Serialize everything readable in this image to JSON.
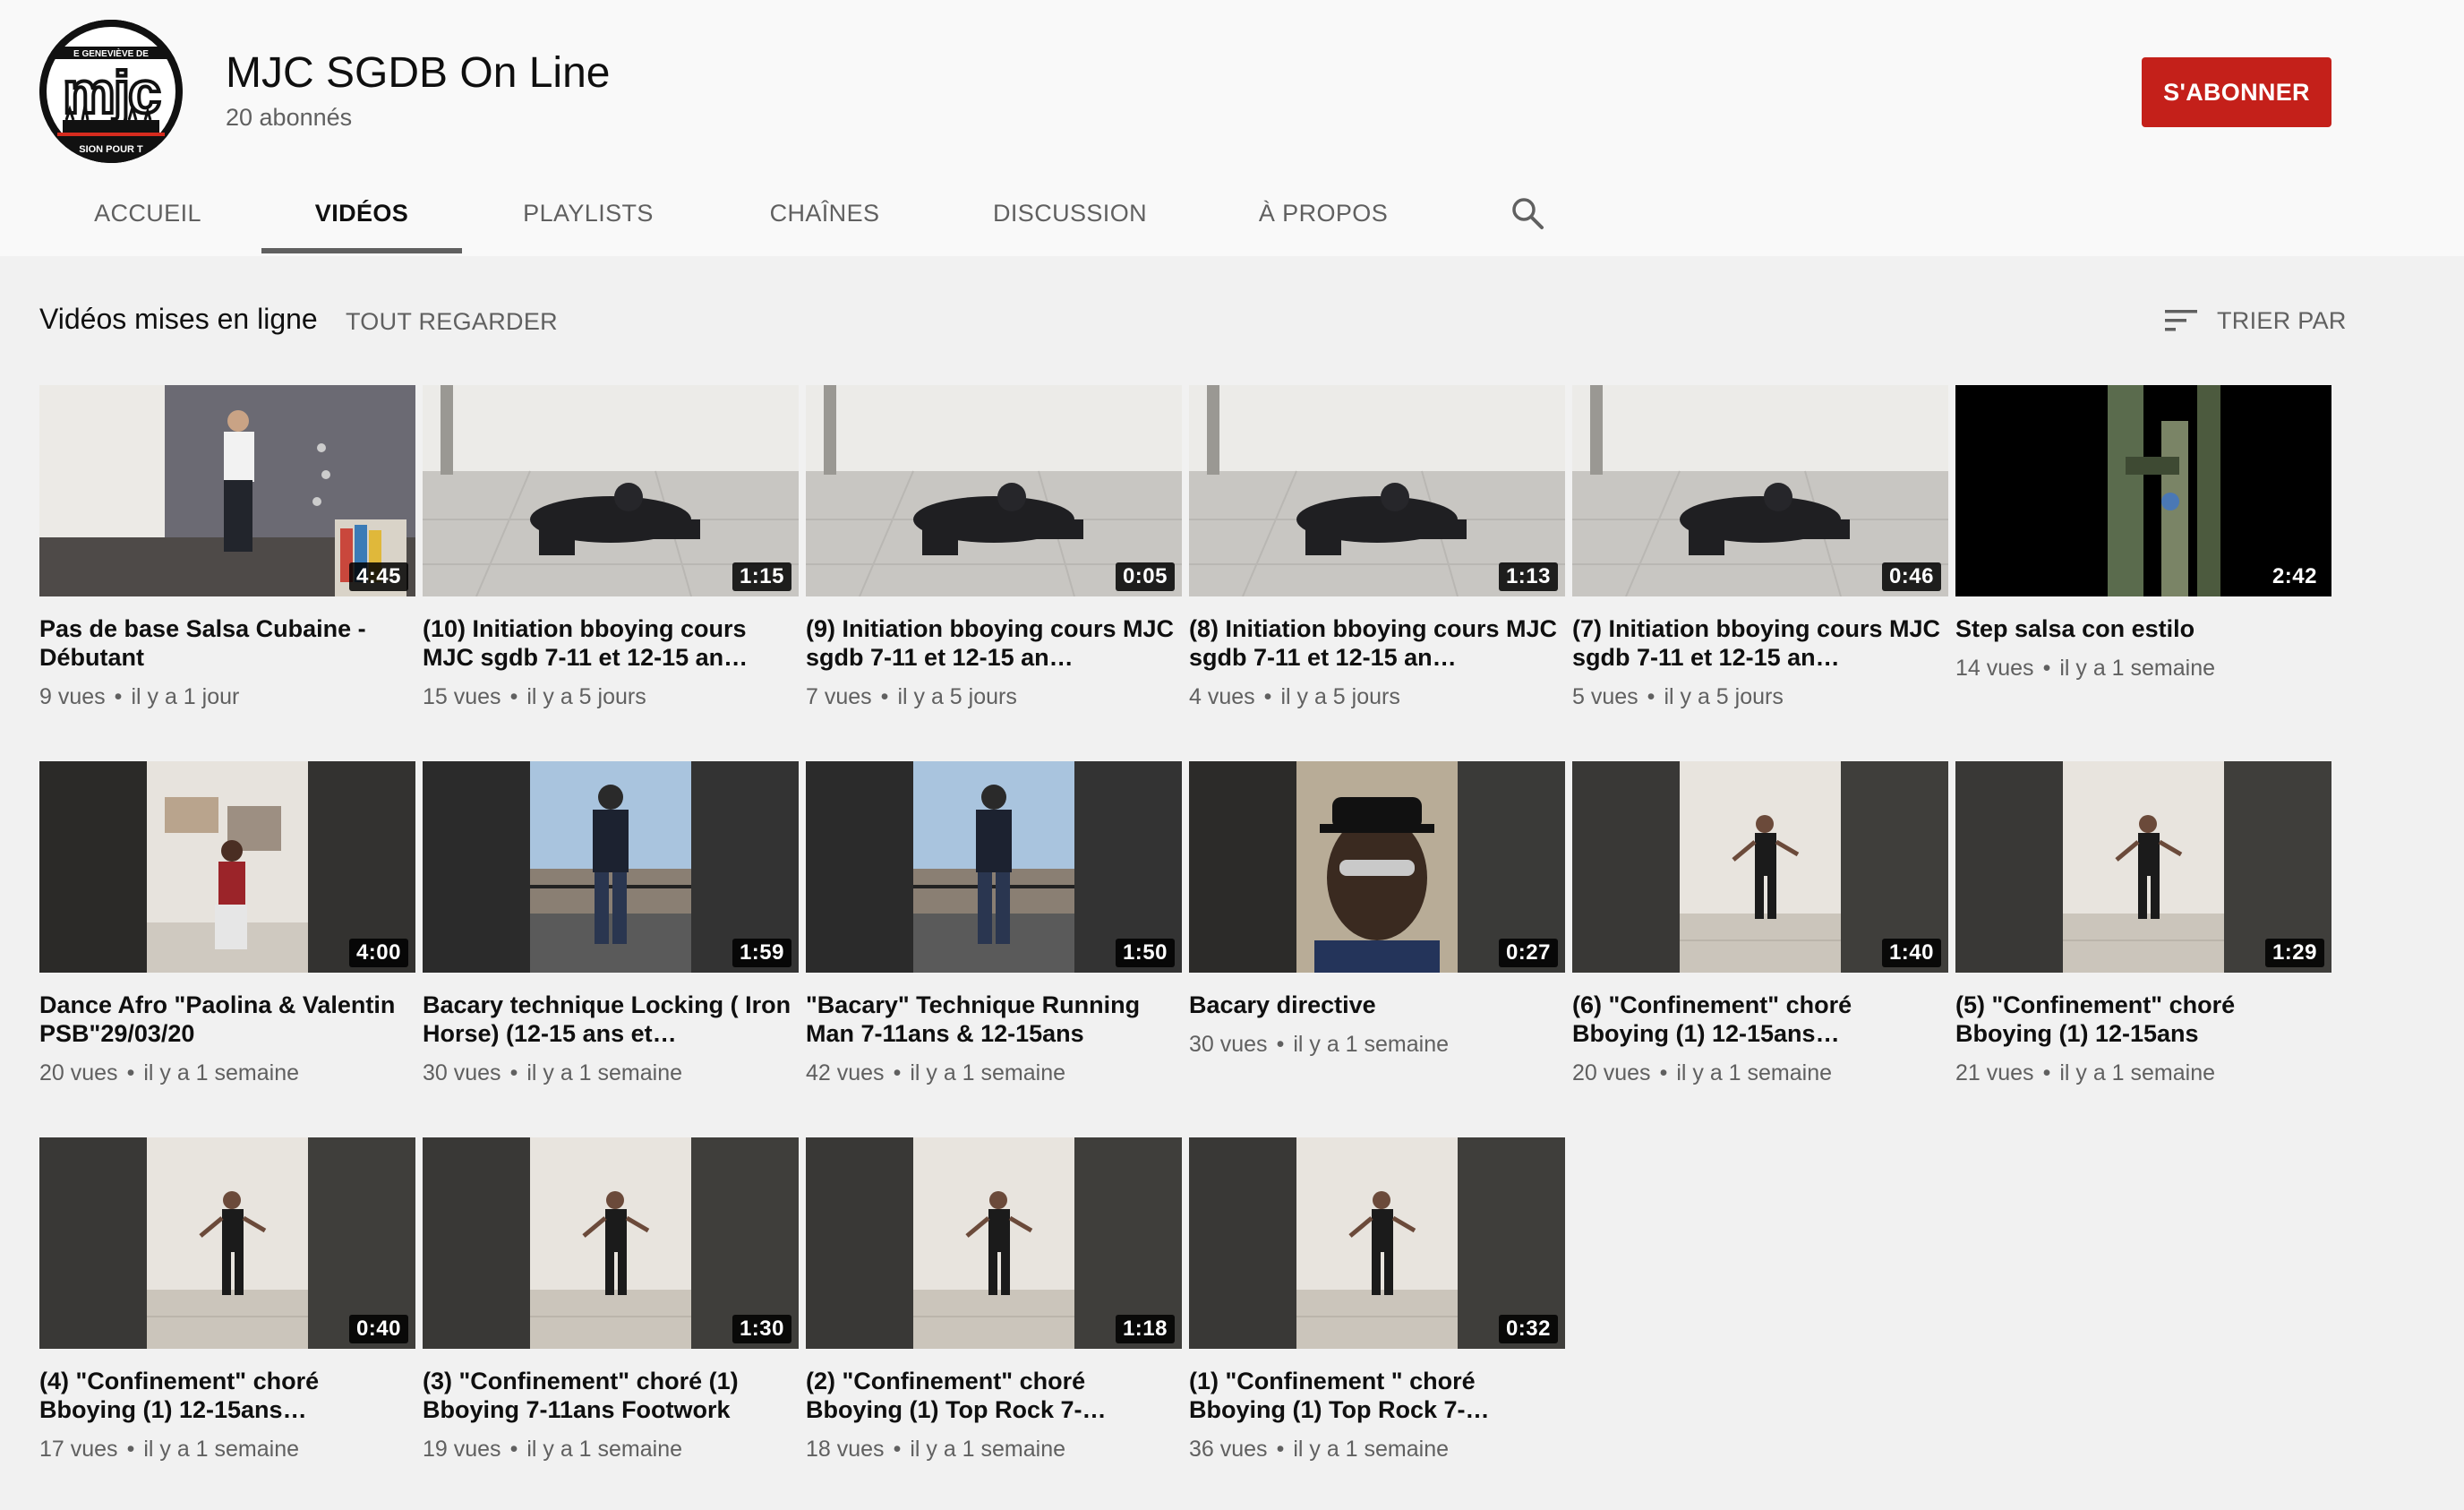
{
  "channel": {
    "name": "MJC SGDB On Line",
    "subscribers": "20 abonnés",
    "subscribe_label": "S'ABONNER",
    "avatar_text": {
      "top": "E GENEVIÈVE DE",
      "main": "mjc",
      "bottom": "SION POUR T"
    }
  },
  "tabs": [
    {
      "label": "Accueil"
    },
    {
      "label": "Vidéos",
      "active": true
    },
    {
      "label": "Playlists"
    },
    {
      "label": "Chaînes"
    },
    {
      "label": "Discussion"
    },
    {
      "label": "À propos"
    }
  ],
  "section": {
    "title": "Vidéos mises en ligne",
    "play_all": "Tout regarder",
    "sort_label": "Trier par"
  },
  "videos": [
    {
      "title": "Pas de base Salsa Cubaine - Débutant",
      "duration": "4:45",
      "views": "9 vues",
      "age": "il y a 1 jour",
      "scene": "room"
    },
    {
      "title": "(10) Initiation bboying cours MJC sgdb 7-11 et 12-15 an…",
      "duration": "1:15",
      "views": "15 vues",
      "age": "il y a 5 jours",
      "scene": "floor"
    },
    {
      "title": "(9) Initiation bboying cours MJC sgdb 7-11 et 12-15 an…",
      "duration": "0:05",
      "views": "7 vues",
      "age": "il y a 5 jours",
      "scene": "floor"
    },
    {
      "title": "(8) Initiation bboying cours MJC sgdb 7-11 et 12-15 an…",
      "duration": "1:13",
      "views": "4 vues",
      "age": "il y a 5 jours",
      "scene": "floor"
    },
    {
      "title": "(7) Initiation bboying cours MJC sgdb 7-11 et 12-15 an…",
      "duration": "0:46",
      "views": "5 vues",
      "age": "il y a 5 jours",
      "scene": "floor"
    },
    {
      "title": "Step salsa con estilo",
      "duration": "2:42",
      "views": "14 vues",
      "age": "il y a 1 semaine",
      "scene": "dark"
    },
    {
      "title": "Dance Afro \"Paolina & Valentin PSB\"29/03/20",
      "duration": "4:00",
      "views": "20 vues",
      "age": "il y a 1 semaine",
      "scene": "portrait-room"
    },
    {
      "title": "Bacary technique Locking ( Iron Horse) (12-15 ans et…",
      "duration": "1:59",
      "views": "30 vues",
      "age": "il y a 1 semaine",
      "scene": "portrait-outdoor"
    },
    {
      "title": "\"Bacary\" Technique Running Man 7-11ans & 12-15ans",
      "duration": "1:50",
      "views": "42 vues",
      "age": "il y a 1 semaine",
      "scene": "portrait-outdoor"
    },
    {
      "title": "Bacary directive",
      "duration": "0:27",
      "views": "30 vues",
      "age": "il y a 1 semaine",
      "scene": "portrait-face"
    },
    {
      "title": "(6) \"Confinement\" choré Bboying (1) 12-15ans…",
      "duration": "1:40",
      "views": "20 vues",
      "age": "il y a 1 semaine",
      "scene": "portrait-wall"
    },
    {
      "title": "(5) \"Confinement\" choré Bboying (1) 12-15ans",
      "duration": "1:29",
      "views": "21 vues",
      "age": "il y a 1 semaine",
      "scene": "portrait-wall"
    },
    {
      "title": "(4) \"Confinement\" choré Bboying (1) 12-15ans…",
      "duration": "0:40",
      "views": "17 vues",
      "age": "il y a 1 semaine",
      "scene": "portrait-wall"
    },
    {
      "title": "(3) \"Confinement\" choré (1) Bboying 7-11ans Footwork",
      "duration": "1:30",
      "views": "19 vues",
      "age": "il y a 1 semaine",
      "scene": "portrait-wall"
    },
    {
      "title": "(2) \"Confinement\" choré Bboying (1) Top Rock 7-…",
      "duration": "1:18",
      "views": "18 vues",
      "age": "il y a 1 semaine",
      "scene": "portrait-wall"
    },
    {
      "title": "(1) \"Confinement \" choré Bboying (1) Top Rock 7-…",
      "duration": "0:32",
      "views": "36 vues",
      "age": "il y a 1 semaine",
      "scene": "portrait-wall"
    }
  ]
}
